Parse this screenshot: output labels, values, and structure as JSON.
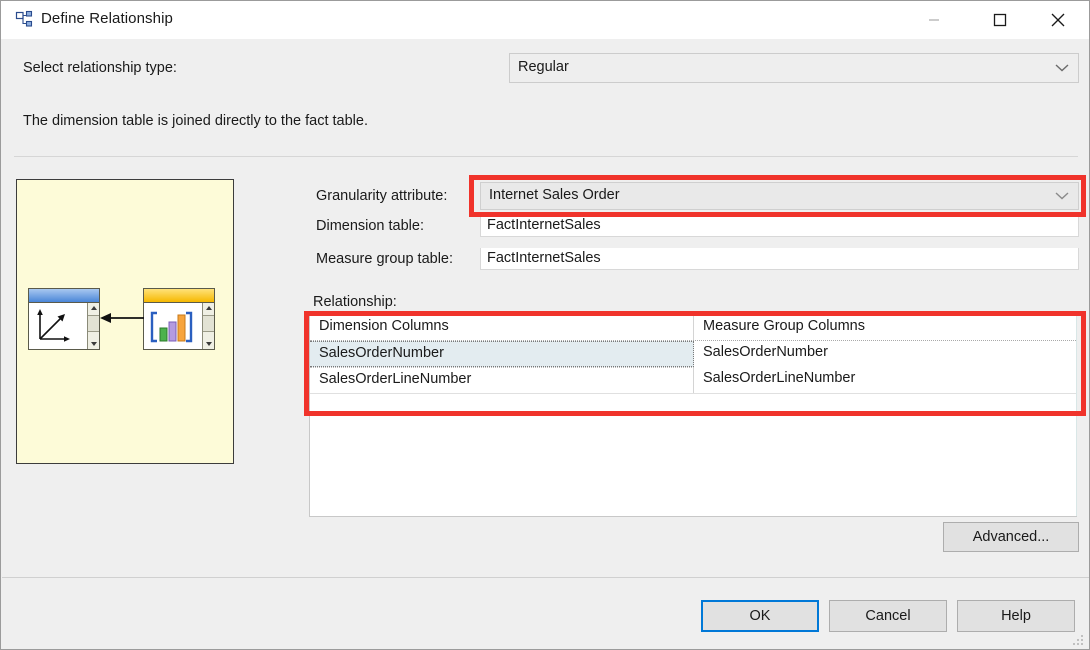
{
  "window": {
    "title": "Define Relationship",
    "icon": "relationship-diagram-icon",
    "controls": {
      "minimize": "minimize-icon",
      "maximize": "maximize-icon",
      "close": "close-icon"
    }
  },
  "top": {
    "relationship_type_label": "Select relationship type:",
    "relationship_type_value": "Regular",
    "description": "The dimension table is joined directly to the fact table."
  },
  "diagram": {
    "dimension_node": "dimension-table-node",
    "measure_node": "measure-group-node",
    "link": "relationship-arrow"
  },
  "form": {
    "granularity_label": "Granularity attribute:",
    "granularity_value": "Internet Sales Order",
    "dimension_table_label": "Dimension table:",
    "dimension_table_value": "FactInternetSales",
    "measure_group_table_label": "Measure group table:",
    "measure_group_table_value": "FactInternetSales",
    "relationship_label": "Relationship:"
  },
  "grid": {
    "columns": [
      "Dimension Columns",
      "Measure Group Columns"
    ],
    "rows": [
      {
        "dimension": "SalesOrderNumber",
        "measure": "SalesOrderNumber",
        "selected": true
      },
      {
        "dimension": "SalesOrderLineNumber",
        "measure": "SalesOrderLineNumber",
        "selected": false
      }
    ]
  },
  "buttons": {
    "advanced": "Advanced...",
    "ok": "OK",
    "cancel": "Cancel",
    "help": "Help"
  },
  "highlights": {
    "color": "#F0332B",
    "boxes": [
      "granularity-attribute-combo",
      "relationship-columns-grid"
    ]
  }
}
